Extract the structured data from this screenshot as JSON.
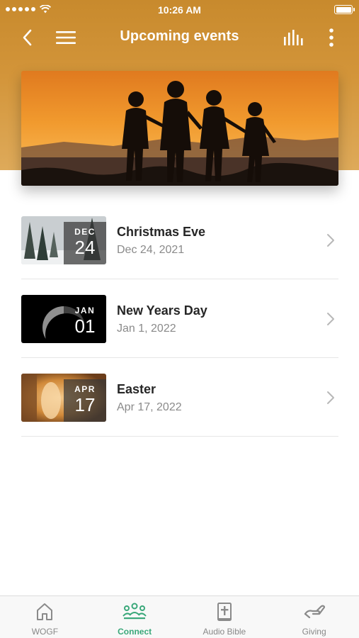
{
  "status_bar": {
    "time": "10:26 AM"
  },
  "nav": {
    "title": "Upcoming events"
  },
  "events": [
    {
      "title": "Christmas Eve",
      "date": "Dec 24, 2021",
      "month": "DEC",
      "day": "24"
    },
    {
      "title": "New Years Day",
      "date": "Jan 1, 2022",
      "month": "JAN",
      "day": "01"
    },
    {
      "title": "Easter",
      "date": "Apr 17, 2022",
      "month": "APR",
      "day": "17"
    }
  ],
  "tabs": [
    {
      "label": "WOGF",
      "icon": "home-icon",
      "active": false
    },
    {
      "label": "Connect",
      "icon": "people-icon",
      "active": true
    },
    {
      "label": "Audio Bible",
      "icon": "bible-icon",
      "active": false
    },
    {
      "label": "Giving",
      "icon": "giving-hand-icon",
      "active": false
    }
  ],
  "colors": {
    "header": "#c88a2d",
    "accent": "#3aa87a"
  }
}
